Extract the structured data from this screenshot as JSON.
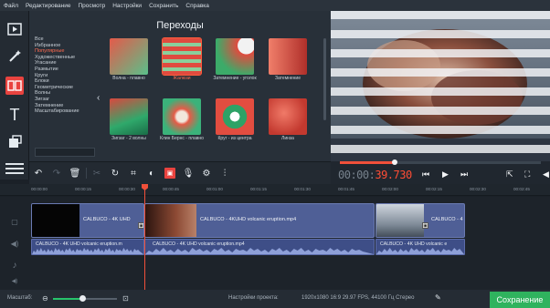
{
  "menu": [
    "Файл",
    "Редактирование",
    "Просмотр",
    "Настройки",
    "Сохранить",
    "Справка"
  ],
  "transitions": {
    "title": "Переходы",
    "categories": [
      {
        "label": "Все",
        "selected": false
      },
      {
        "label": "Избранное",
        "selected": false
      },
      {
        "label": "Популярные",
        "selected": true
      },
      {
        "label": "Художественные",
        "selected": false
      },
      {
        "label": "Угасание",
        "selected": false
      },
      {
        "label": "Размытие",
        "selected": false
      },
      {
        "label": "Круги",
        "selected": false
      },
      {
        "label": "Блоки",
        "selected": false
      },
      {
        "label": "Геометрические",
        "selected": false
      },
      {
        "label": "Волны",
        "selected": false
      },
      {
        "label": "Зигзаг",
        "selected": false
      },
      {
        "label": "Затемнение",
        "selected": false
      },
      {
        "label": "Масштабирование",
        "selected": false
      }
    ],
    "items": [
      {
        "label": "Волна - плавно",
        "style": "wave"
      },
      {
        "label": "Жалюзи",
        "style": "blinds",
        "selected": true
      },
      {
        "label": "Затемнение - уголок",
        "style": "corner"
      },
      {
        "label": "Затемнение",
        "style": "fade"
      },
      {
        "label": "Зигзаг - 2 волны",
        "style": "zigzag"
      },
      {
        "label": "Клин Бернс - плавно",
        "style": "burns"
      },
      {
        "label": "Круг - из центра",
        "style": "circle"
      },
      {
        "label": "Линза",
        "style": "lens"
      }
    ]
  },
  "preview": {
    "timecode_dim": "00:00:",
    "timecode_active": "39.730"
  },
  "ruler_ticks": [
    "00:00:00",
    "00:00:15",
    "00:00:30",
    "00:00:45",
    "00:01:00",
    "00:01:15",
    "00:01:30",
    "00:01:45",
    "00:02:00",
    "00:02:15",
    "00:02:30",
    "00:02:45"
  ],
  "timeline": {
    "clips": [
      {
        "label": "CALBUCO - 4K UHD"
      },
      {
        "label": "CALBUCO - 4KUHD volcanic eruption.mp4"
      },
      {
        "label": "CALBUCO - 4"
      }
    ],
    "audio": [
      {
        "label": "CALBUCO - 4K UHD volcanic eruption.m"
      },
      {
        "label": "CALBUCO - 4K UHD volcanic eruption.mp4"
      },
      {
        "label": "CALBUCO - 4K UHD volcanic e"
      }
    ]
  },
  "status": {
    "zoom_label": "Масштаб:",
    "zoom_level": 0.45,
    "project_label": "Настройки проекта:",
    "project_value": "1920x1080 16:9 29.97 FPS, 44100 Гц Стерео"
  },
  "save_label": "Сохранение",
  "colors": {
    "accent": "#e9433f",
    "save": "#2fb35e",
    "clip": "#4f5f96"
  }
}
